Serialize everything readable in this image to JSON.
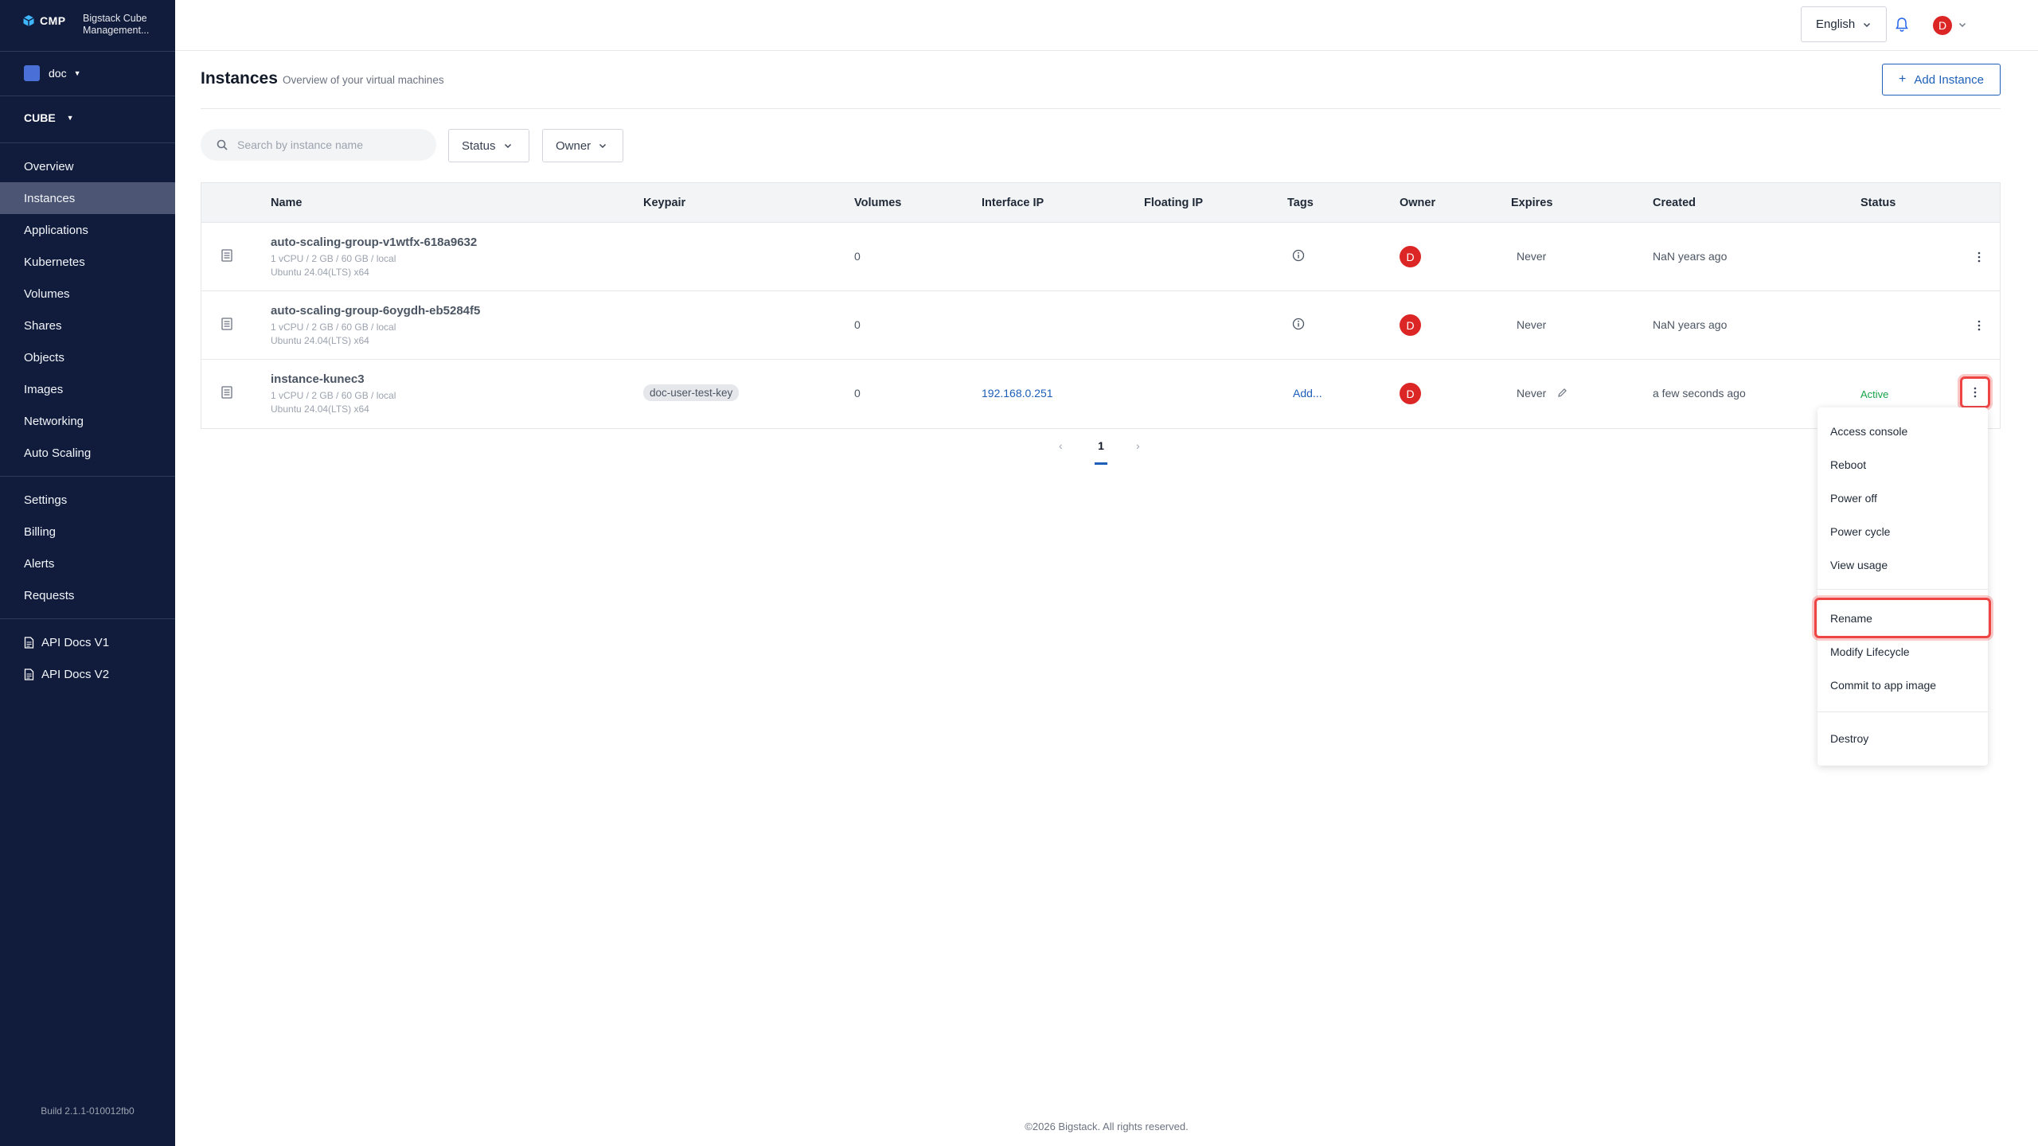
{
  "sidebar": {
    "brand": "CMP",
    "brand_title": "Bigstack Cube Management...",
    "workspace": "doc",
    "region": "CUBE",
    "nav_main": [
      {
        "label": "Overview"
      },
      {
        "label": "Instances",
        "active": true
      },
      {
        "label": "Applications"
      },
      {
        "label": "Kubernetes"
      },
      {
        "label": "Volumes"
      },
      {
        "label": "Shares"
      },
      {
        "label": "Objects"
      },
      {
        "label": "Images"
      },
      {
        "label": "Networking"
      },
      {
        "label": "Auto Scaling"
      }
    ],
    "nav_settings": [
      {
        "label": "Settings"
      },
      {
        "label": "Billing"
      },
      {
        "label": "Alerts"
      },
      {
        "label": "Requests"
      }
    ],
    "nav_docs": [
      {
        "label": "API Docs V1"
      },
      {
        "label": "API Docs V2"
      }
    ],
    "build": "Build 2.1.1-010012fb0"
  },
  "topbar": {
    "language": "English",
    "avatar_initial": "D"
  },
  "page": {
    "title": "Instances",
    "subtitle": "Overview of your virtual machines",
    "add_button": "Add Instance",
    "search_placeholder": "Search by instance name",
    "filter_status": "Status",
    "filter_owner": "Owner"
  },
  "table": {
    "columns": [
      "Name",
      "Keypair",
      "Volumes",
      "Interface IP",
      "Floating IP",
      "Tags",
      "Owner",
      "Expires",
      "Created",
      "Status"
    ],
    "rows": [
      {
        "name": "auto-scaling-group-v1wtfx-618a9632",
        "spec": "1 vCPU / 2 GB / 60 GB / local",
        "os": "Ubuntu 24.04(LTS) x64",
        "keypair": "",
        "volumes": "0",
        "interface_ip": "",
        "floating_ip": "",
        "tags": "info-icon",
        "owner": "D",
        "expires": "Never",
        "created": "NaN years ago",
        "status": ""
      },
      {
        "name": "auto-scaling-group-6oygdh-eb5284f5",
        "spec": "1 vCPU / 2 GB / 60 GB / local",
        "os": "Ubuntu 24.04(LTS) x64",
        "keypair": "",
        "volumes": "0",
        "interface_ip": "",
        "floating_ip": "",
        "tags": "info-icon",
        "owner": "D",
        "expires": "Never",
        "created": "NaN years ago",
        "status": ""
      },
      {
        "name": "instance-kunec3",
        "spec": "1 vCPU / 2 GB / 60 GB / local",
        "os": "Ubuntu 24.04(LTS) x64",
        "keypair": "doc-user-test-key",
        "volumes": "0",
        "interface_ip": "192.168.0.251",
        "floating_ip": "",
        "tags": "Add...",
        "owner": "D",
        "expires": "Never",
        "created": "a few seconds ago",
        "status": "Active"
      }
    ]
  },
  "pagination": {
    "current": "1"
  },
  "action_menu": {
    "group1": [
      "Access console",
      "Reboot",
      "Power off",
      "Power cycle",
      "View usage"
    ],
    "group2": [
      "Rename",
      "Modify Lifecycle",
      "Commit to app image"
    ],
    "group3": [
      "Destroy"
    ],
    "highlighted": "Rename"
  },
  "footer": "©2026 Bigstack. All rights reserved.",
  "colors": {
    "sidebar_bg": "#111c3d",
    "active_nav": "#4c5573",
    "accent": "#1d5fb8",
    "avatar": "#dc2626",
    "status_active": "#16a34a",
    "highlight": "#ef4444"
  }
}
